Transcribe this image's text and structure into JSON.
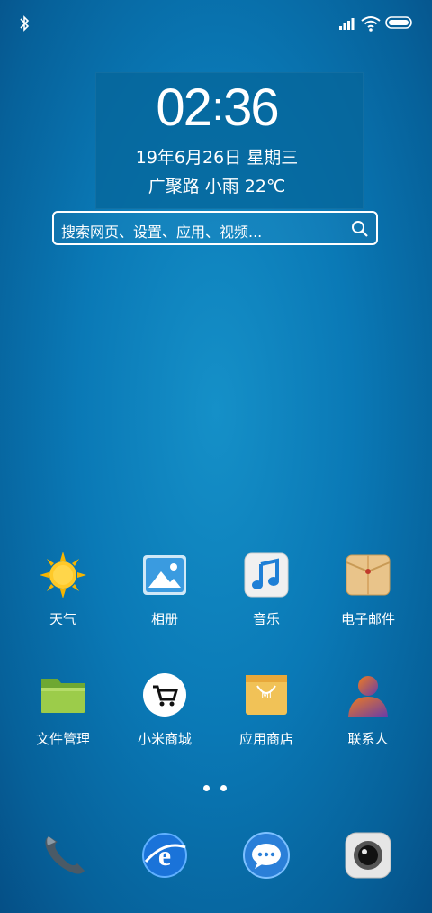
{
  "widget": {
    "time_hour": "02",
    "time_minute": "36",
    "date": "19年6月26日 星期三",
    "weather": "广聚路 小雨 22℃"
  },
  "search": {
    "placeholder": "搜索网页、设置、应用、视频..."
  },
  "apps_row1": [
    {
      "label": "天气",
      "icon": "sun-icon"
    },
    {
      "label": "相册",
      "icon": "gallery-icon"
    },
    {
      "label": "音乐",
      "icon": "music-note-icon"
    },
    {
      "label": "电子邮件",
      "icon": "envelope-icon"
    }
  ],
  "apps_row2": [
    {
      "label": "文件管理",
      "icon": "folder-icon"
    },
    {
      "label": "小米商城",
      "icon": "shopping-cart-icon"
    },
    {
      "label": "应用商店",
      "icon": "shopping-bag-icon"
    },
    {
      "label": "联系人",
      "icon": "person-icon"
    }
  ],
  "dock": [
    {
      "icon": "phone-handset-icon"
    },
    {
      "icon": "browser-e-icon"
    },
    {
      "icon": "message-bubble-icon"
    },
    {
      "icon": "camera-lens-icon"
    }
  ],
  "colors": {
    "accent": "#0a79b6",
    "folder": "#8bc34a",
    "bag": "#f2c45a"
  }
}
